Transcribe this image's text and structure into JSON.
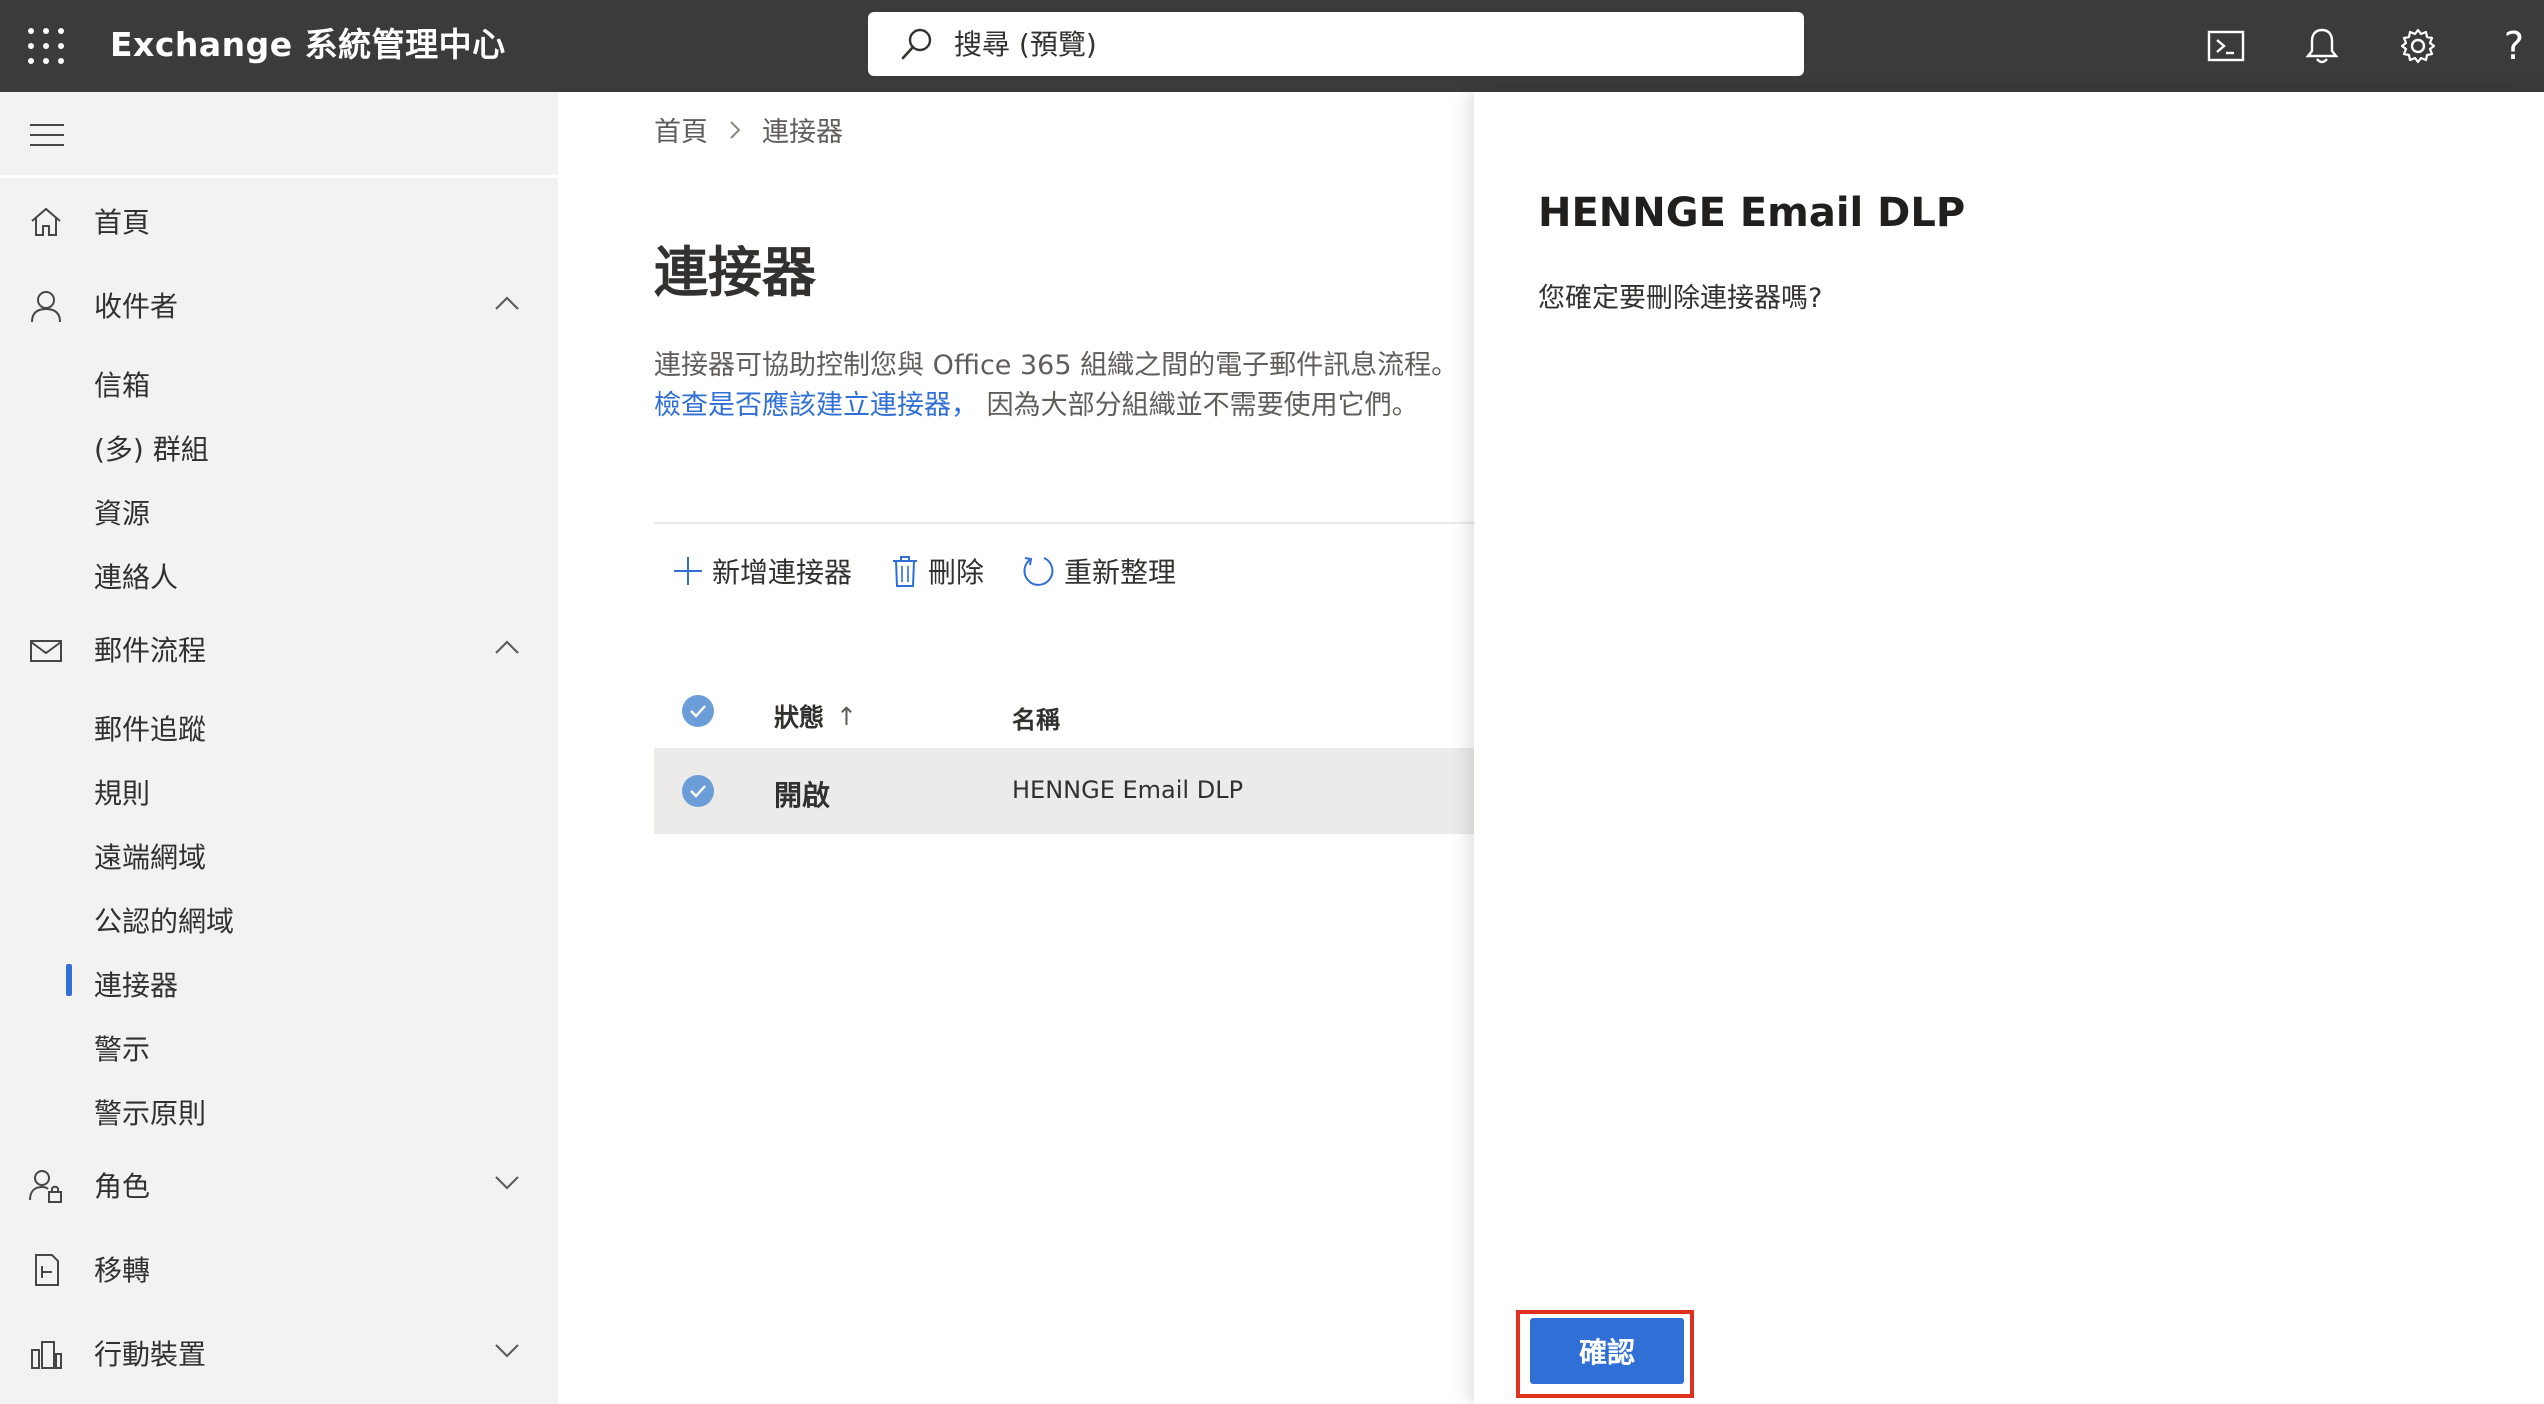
{
  "topbar": {
    "title": "Exchange 系統管理中心",
    "search_placeholder": "搜尋 (預覽)",
    "icons": [
      "waffle-icon",
      "terminal-icon",
      "bell-icon",
      "gear-icon",
      "help-icon"
    ],
    "help_glyph": "?"
  },
  "nav": {
    "items": [
      {
        "label": "首頁",
        "icon": "home-icon"
      },
      {
        "label": "收件者",
        "icon": "person-icon",
        "expanded": true
      },
      {
        "label": "郵件流程",
        "icon": "mail-icon",
        "expanded": true
      },
      {
        "label": "角色",
        "icon": "roles-icon",
        "expanded": false
      },
      {
        "label": "移轉",
        "icon": "migration-icon"
      },
      {
        "label": "行動裝置",
        "icon": "mobile-icon",
        "expanded": false
      }
    ],
    "recipients_sub": [
      "信箱",
      "(多) 群組",
      "資源",
      "連絡人"
    ],
    "mailflow_sub": [
      "郵件追蹤",
      "規則",
      "遠端網域",
      "公認的網域",
      "連接器",
      "警示",
      "警示原則"
    ],
    "selected": "連接器"
  },
  "main": {
    "breadcrumb": [
      "首頁",
      "連接器"
    ],
    "title": "連接器",
    "desc_line1": "連接器可協助控制您與 Office 365 組織之間的電子郵件訊息流程。",
    "desc_link": "檢查是否應該建立連接器，",
    "desc_line2_rest": " 因為大部分組織並不需要使用它們。",
    "commands": {
      "add": "新增連接器",
      "delete": "刪除",
      "refresh": "重新整理"
    },
    "table": {
      "headers": {
        "status": "狀態",
        "sort_arrow": "↑",
        "name": "名稱"
      },
      "rows": [
        {
          "status": "開啟",
          "name": "HENNGE Email DLP"
        }
      ]
    }
  },
  "panel": {
    "title": "HENNGE Email DLP",
    "message": "您確定要刪除連接器嗎?",
    "confirm_label": "確認"
  },
  "colors": {
    "topbar": "#3b3b3b",
    "accent": "#2f6fd6",
    "highlight_outline": "#e03020",
    "nav_bg": "#f3f2f1"
  }
}
